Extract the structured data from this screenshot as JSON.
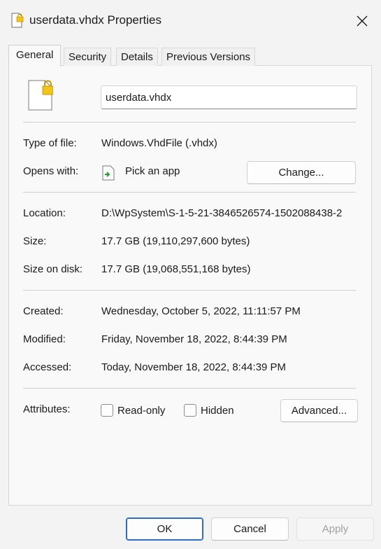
{
  "window": {
    "title": "userdata.vhdx Properties"
  },
  "tabs": [
    {
      "label": "General",
      "active": true
    },
    {
      "label": "Security",
      "active": false
    },
    {
      "label": "Details",
      "active": false
    },
    {
      "label": "Previous Versions",
      "active": false
    }
  ],
  "general": {
    "file_name": "userdata.vhdx",
    "type_label": "Type of file:",
    "type_value": "Windows.VhdFile (.vhdx)",
    "opens_label": "Opens with:",
    "opens_value": "Pick an app",
    "change_button": "Change...",
    "location_label": "Location:",
    "location_value": "D:\\WpSystem\\S-1-5-21-3846526574-1502088438-2",
    "size_label": "Size:",
    "size_value": "17.7 GB (19,110,297,600 bytes)",
    "size_disk_label": "Size on disk:",
    "size_disk_value": "17.7 GB (19,068,551,168 bytes)",
    "created_label": "Created:",
    "created_value": "Wednesday, October 5, 2022, 11:11:57 PM",
    "modified_label": "Modified:",
    "modified_value": "Friday, November 18, 2022, 8:44:39 PM",
    "accessed_label": "Accessed:",
    "accessed_value": "Today, November 18, 2022, 8:44:39 PM",
    "attributes_label": "Attributes:",
    "readonly_label": "Read-only",
    "hidden_label": "Hidden",
    "advanced_button": "Advanced..."
  },
  "footer": {
    "ok": "OK",
    "cancel": "Cancel",
    "apply": "Apply"
  },
  "icons": {
    "title": "file-lock-icon",
    "file": "file-lock-icon",
    "app": "app-icon",
    "close": "close-icon"
  },
  "colors": {
    "accent": "#2f6cc2",
    "lock": "#f0c419"
  }
}
